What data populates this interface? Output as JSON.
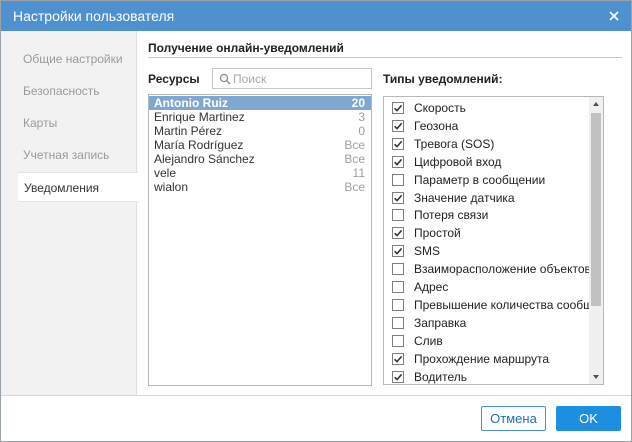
{
  "window": {
    "title": "Настройки пользователя"
  },
  "sidebar": {
    "items": [
      {
        "label": "Общие настройки",
        "active": false
      },
      {
        "label": "Безопасность",
        "active": false
      },
      {
        "label": "Карты",
        "active": false
      },
      {
        "label": "Учетная запись",
        "active": false
      },
      {
        "label": "Уведомления",
        "active": true
      }
    ]
  },
  "section": {
    "title": "Получение онлайн-уведомлений"
  },
  "resources": {
    "label": "Ресурсы",
    "search_placeholder": "Поиск",
    "items": [
      {
        "name": "Antonio Ruiz",
        "count": "20",
        "selected": true
      },
      {
        "name": "Enrique Martinez",
        "count": "3",
        "selected": false
      },
      {
        "name": "Martin Pérez",
        "count": "0",
        "selected": false
      },
      {
        "name": "María Rodríguez",
        "count": "Все",
        "selected": false
      },
      {
        "name": "Alejandro Sánchez",
        "count": "Все",
        "selected": false
      },
      {
        "name": "vele",
        "count": "11",
        "selected": false
      },
      {
        "name": "wialon",
        "count": "Все",
        "selected": false
      }
    ]
  },
  "types": {
    "label": "Типы уведомлений:",
    "items": [
      {
        "label": "Скорость",
        "checked": true
      },
      {
        "label": "Геозона",
        "checked": true
      },
      {
        "label": "Тревога (SOS)",
        "checked": true
      },
      {
        "label": "Цифровой вход",
        "checked": true
      },
      {
        "label": "Параметр в сообщении",
        "checked": false
      },
      {
        "label": "Значение датчика",
        "checked": true
      },
      {
        "label": "Потеря связи",
        "checked": false
      },
      {
        "label": "Простой",
        "checked": true
      },
      {
        "label": "SMS",
        "checked": true
      },
      {
        "label": "Взаиморасположение объектов",
        "checked": false
      },
      {
        "label": "Адрес",
        "checked": false
      },
      {
        "label": "Превышение количества сообщений",
        "checked": false
      },
      {
        "label": "Заправка",
        "checked": false
      },
      {
        "label": "Слив",
        "checked": false
      },
      {
        "label": "Прохождение маршрута",
        "checked": true
      },
      {
        "label": "Водитель",
        "checked": true
      }
    ]
  },
  "footer": {
    "cancel_label": "Отмена",
    "ok_label": "OK"
  },
  "colors": {
    "titlebar": "#4f91cf",
    "selected_row": "#7ea8d2",
    "ok_button": "#1c8fe0"
  }
}
